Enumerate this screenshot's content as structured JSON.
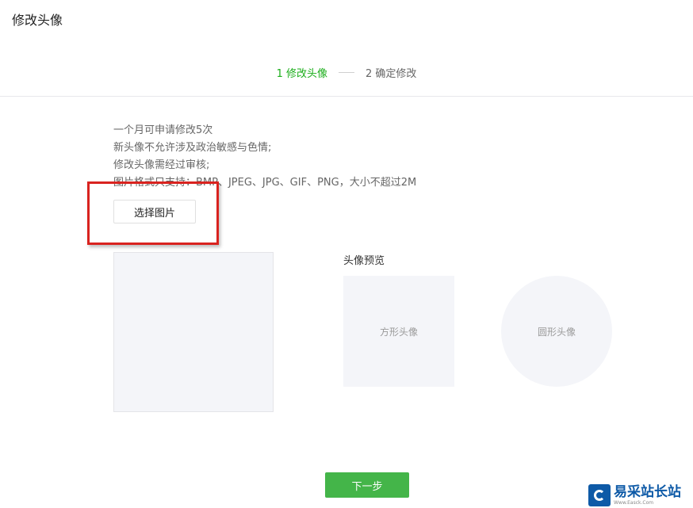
{
  "page": {
    "title": "修改头像"
  },
  "steps": [
    {
      "label": "1 修改头像",
      "active": true
    },
    {
      "label": "2 确定修改",
      "active": false
    }
  ],
  "tips": [
    "一个月可申请修改5次",
    "新头像不允许涉及政治敏感与色情;",
    "修改头像需经过审核;",
    "图片格式只支持：BMP、JPEG、JPG、GIF、PNG，大小不超过2M"
  ],
  "upload": {
    "select_label": "选择图片"
  },
  "preview": {
    "title": "头像预览",
    "square_label": "方形头像",
    "round_label": "圆形头像"
  },
  "footer": {
    "next_label": "下一步"
  },
  "watermark": {
    "text": "易采站长站",
    "sub": "Www.Easck.Com"
  },
  "colors": {
    "accent": "#1aad19",
    "button_green": "#44b549",
    "highlight_red": "#d9231f",
    "placeholder_bg": "#f4f5f9"
  }
}
